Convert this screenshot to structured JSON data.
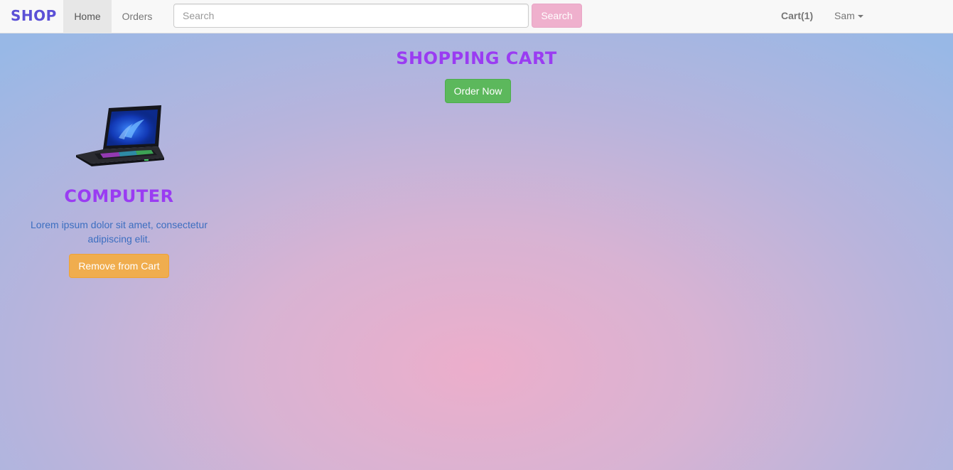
{
  "navbar": {
    "brand": "SHOP",
    "links": [
      {
        "label": "Home",
        "active": true
      },
      {
        "label": "Orders",
        "active": false
      }
    ],
    "search": {
      "placeholder": "Search",
      "value": "",
      "button_label": "Search"
    },
    "cart_label": "Cart(1)",
    "user_label": "Sam"
  },
  "main": {
    "title": "SHOPPING CART",
    "order_button_label": "Order Now",
    "products": [
      {
        "name": "COMPUTER",
        "description": "Lorem ipsum dolor sit amet, consectetur adipiscing elit.",
        "image_icon": "laptop-image",
        "remove_button_label": "Remove from Cart"
      }
    ]
  },
  "colors": {
    "brand": "#5b50d6",
    "title": "#9a3cf2",
    "search_button": "#efb0cd",
    "order_button": "#5cb85c",
    "remove_button": "#f0ad4e",
    "description_text": "#3c6ec0"
  }
}
